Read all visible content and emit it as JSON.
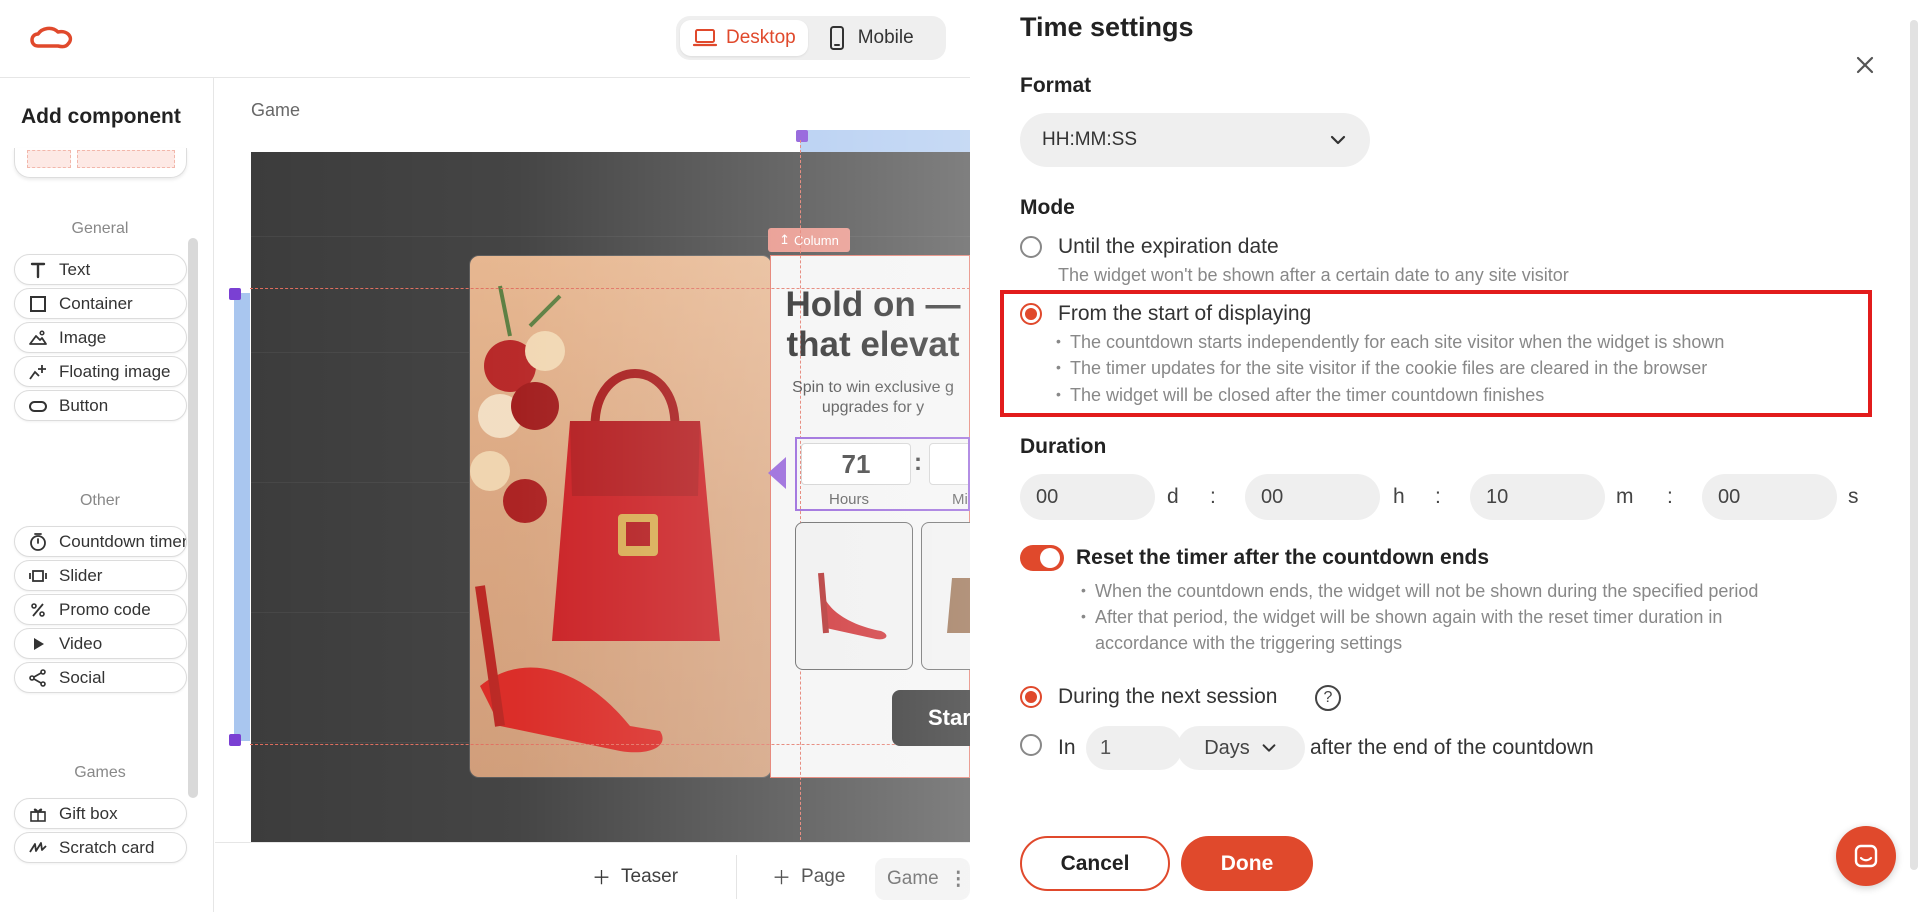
{
  "header": {
    "view_toggle": {
      "desktop_label": "Desktop",
      "mobile_label": "Mobile"
    }
  },
  "sidebar": {
    "title": "Add component",
    "sections": {
      "general": "General",
      "other": "Other",
      "games": "Games"
    },
    "general_items": [
      {
        "label": "Text",
        "icon": "text-icon"
      },
      {
        "label": "Container",
        "icon": "container-icon"
      },
      {
        "label": "Image",
        "icon": "image-icon"
      },
      {
        "label": "Floating image",
        "icon": "floating-image-icon"
      },
      {
        "label": "Button",
        "icon": "button-icon"
      }
    ],
    "other_items": [
      {
        "label": "Countdown timer",
        "icon": "timer-icon"
      },
      {
        "label": "Slider",
        "icon": "slider-icon"
      },
      {
        "label": "Promo code",
        "icon": "percent-icon"
      },
      {
        "label": "Video",
        "icon": "play-icon"
      },
      {
        "label": "Social",
        "icon": "share-icon"
      }
    ],
    "games_items": [
      {
        "label": "Gift box",
        "icon": "gift-icon"
      },
      {
        "label": "Scratch card",
        "icon": "scratch-icon"
      }
    ]
  },
  "canvas": {
    "breadcrumb": "Game",
    "column_tag": "Column",
    "popup": {
      "title_line1": "Hold on —",
      "title_line2": "that elevat",
      "subtitle_line1": "Spin to win exclusive g",
      "subtitle_line2": "upgrades for y",
      "timer_hours_value": "71",
      "timer_separator": ":",
      "timer_hours_label": "Hours",
      "timer_minutes_label": "Mi",
      "start_button": "Star"
    }
  },
  "bottom_bar": {
    "teaser": "Teaser",
    "page": "Page",
    "game_tab": "Game"
  },
  "panel": {
    "title": "Time settings",
    "format_label": "Format",
    "format_value": "HH:MM:SS",
    "mode_label": "Mode",
    "modes": [
      {
        "title": "Until the expiration date",
        "desc": "The widget won't be shown after a certain date to any site visitor",
        "selected": false
      },
      {
        "title": "From the start of displaying",
        "selected": true,
        "bullets": [
          "The countdown starts independently for each site visitor when the widget is shown",
          "The timer updates for the site visitor if the cookie files are cleared in the browser",
          "The widget will be closed after the timer countdown finishes"
        ]
      }
    ],
    "duration_label": "Duration",
    "duration": {
      "days": "00",
      "days_unit": "d",
      "hours": "00",
      "hours_unit": "h",
      "minutes": "10",
      "minutes_unit": "m",
      "seconds": "00",
      "seconds_unit": "s",
      "separator": ":"
    },
    "reset": {
      "enabled": true,
      "title": "Reset the timer after the countdown ends",
      "bullets": [
        "When the countdown ends, the widget will not be shown during the specified period",
        "After that period, the widget will be shown again with the reset timer duration in",
        "accordance with the triggering settings"
      ]
    },
    "reset_options": {
      "next_session": "During the next session",
      "in_label": "In",
      "in_value": "1",
      "unit_value": "Days",
      "after_label": "after the end of the countdown",
      "help": "?"
    },
    "buttons": {
      "cancel": "Cancel",
      "done": "Done"
    }
  },
  "colors": {
    "accent": "#e0492c",
    "highlight": "#e21c1c",
    "selection": "#8a52d6"
  }
}
